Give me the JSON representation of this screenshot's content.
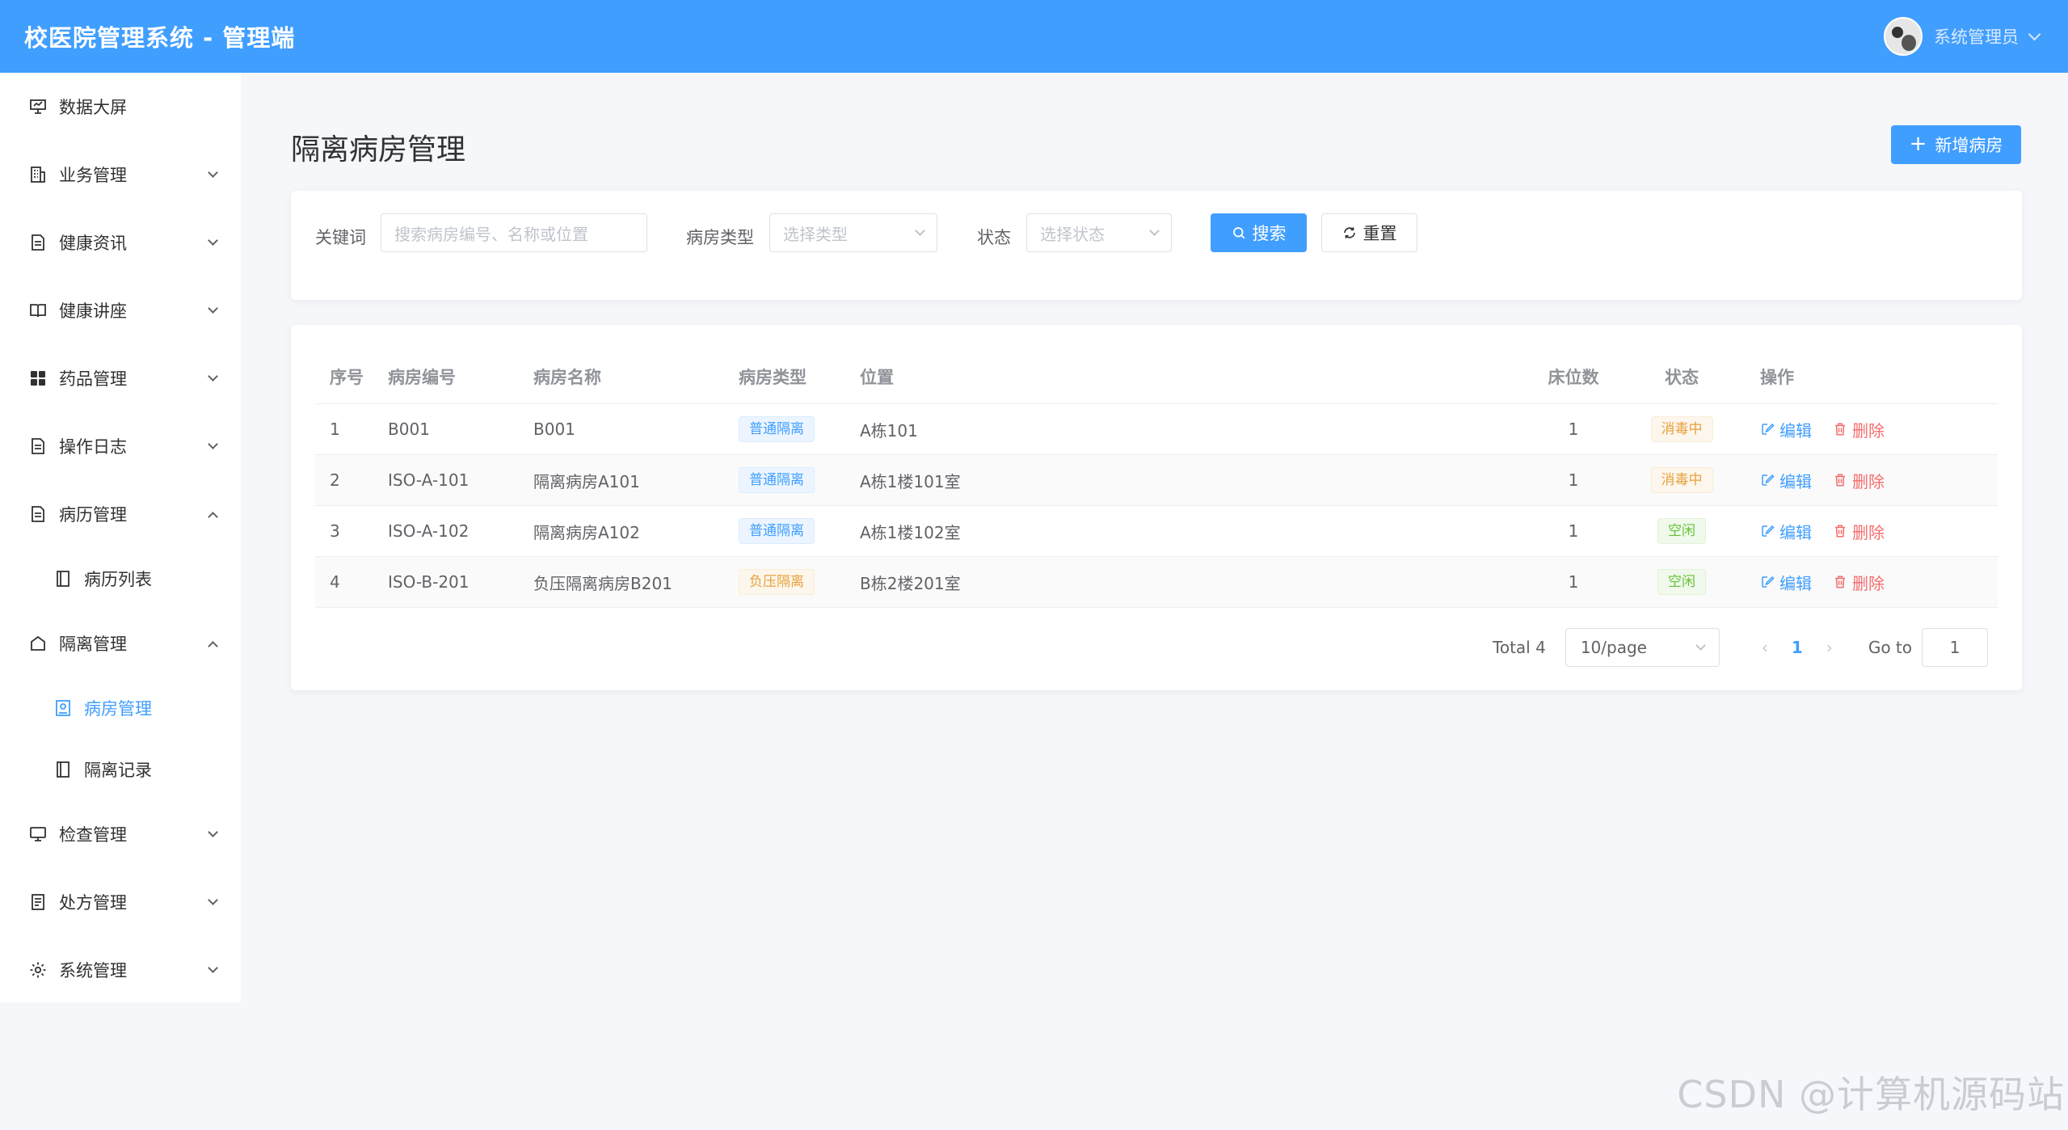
{
  "header": {
    "title": "校医院管理系统 - 管理端",
    "user_name": "系统管理员"
  },
  "sidebar": {
    "items": [
      {
        "label": "数据大屏",
        "icon": "presentation-icon"
      },
      {
        "label": "业务管理",
        "icon": "building-icon"
      },
      {
        "label": "健康资讯",
        "icon": "document-icon"
      },
      {
        "label": "健康讲座",
        "icon": "book-icon"
      },
      {
        "label": "药品管理",
        "icon": "grid-icon"
      },
      {
        "label": "操作日志",
        "icon": "document-icon"
      },
      {
        "label": "病历管理",
        "icon": "document-icon"
      },
      {
        "label": "病历列表",
        "icon": "notebook-icon"
      },
      {
        "label": "隔离管理",
        "icon": "home-icon"
      },
      {
        "label": "病房管理",
        "icon": "picture-icon"
      },
      {
        "label": "隔离记录",
        "icon": "notebook-icon"
      },
      {
        "label": "检查管理",
        "icon": "monitor-icon"
      },
      {
        "label": "处方管理",
        "icon": "tickets-icon"
      },
      {
        "label": "系统管理",
        "icon": "gear-icon"
      }
    ]
  },
  "main": {
    "page_title": "隔离病房管理",
    "add_button": "新增病房"
  },
  "filters": {
    "keyword_label": "关键词",
    "keyword_placeholder": "搜索病房编号、名称或位置",
    "type_label": "病房类型",
    "type_placeholder": "选择类型",
    "status_label": "状态",
    "status_placeholder": "选择状态",
    "search_button": "搜索",
    "reset_button": "重置"
  },
  "table": {
    "columns": [
      "序号",
      "病房编号",
      "病房名称",
      "病房类型",
      "位置",
      "床位数",
      "状态",
      "操作"
    ],
    "edit_label": "编辑",
    "delete_label": "删除",
    "rows": [
      {
        "idx": "1",
        "code": "B001",
        "name": "B001",
        "type": "普通隔离",
        "location": "A栋101",
        "beds": "1",
        "status": "消毒中"
      },
      {
        "idx": "2",
        "code": "ISO-A-101",
        "name": "隔离病房A101",
        "type": "普通隔离",
        "location": "A栋1楼101室",
        "beds": "1",
        "status": "消毒中"
      },
      {
        "idx": "3",
        "code": "ISO-A-102",
        "name": "隔离病房A102",
        "type": "普通隔离",
        "location": "A栋1楼102室",
        "beds": "1",
        "status": "空闲"
      },
      {
        "idx": "4",
        "code": "ISO-B-201",
        "name": "负压隔离病房B201",
        "type": "负压隔离",
        "location": "B栋2楼201室",
        "beds": "1",
        "status": "空闲"
      }
    ]
  },
  "pagination": {
    "total": "Total 4",
    "page_size": "10/page",
    "current_page": "1",
    "goto_label": "Go to",
    "goto_value": "1"
  },
  "watermark": "CSDN @计算机源码站",
  "colors": {
    "primary": "#409eff",
    "danger": "#f56c6c",
    "warning": "#e6a23c",
    "success": "#67c23a"
  }
}
